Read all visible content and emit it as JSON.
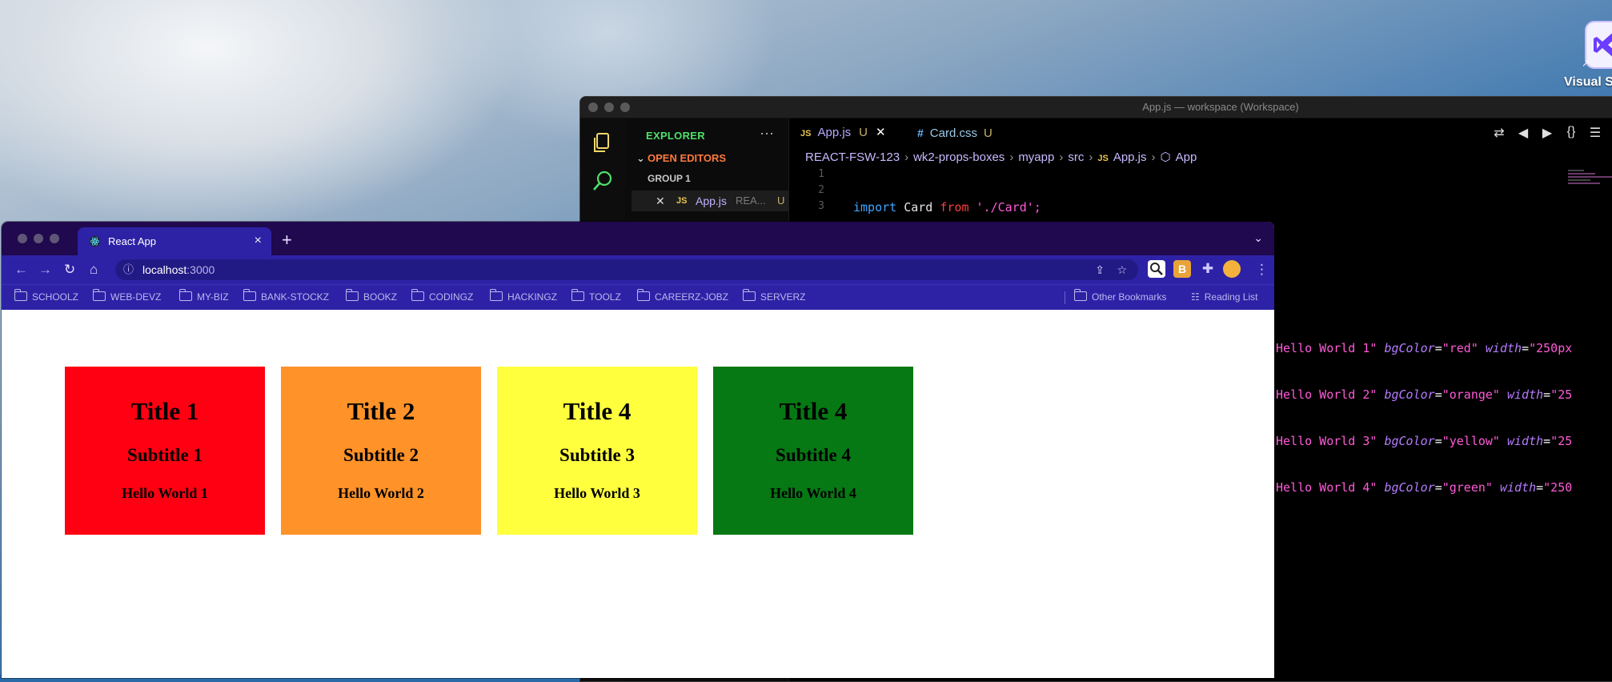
{
  "desktop": {
    "vs_icon_label": "Visual S",
    "vs_icon_alias": "↗"
  },
  "vscode": {
    "window_title": "App.js — workspace (Workspace)",
    "sidebar": {
      "header": "EXPLORER",
      "more": "···",
      "section": "OPEN EDITORS",
      "group": "GROUP 1",
      "file": {
        "close": "✕",
        "icon": "JS",
        "name": "App.js",
        "dir": "REA...",
        "status": "U"
      }
    },
    "tabs": [
      {
        "icon": "JS",
        "label": "App.js",
        "status": "U",
        "close": "✕"
      },
      {
        "icon": "#",
        "label": "Card.css",
        "status": "U"
      }
    ],
    "breadcrumb": [
      "REACT-FSW-123",
      "wk2-props-boxes",
      "myapp",
      "src",
      "App.js",
      "App"
    ],
    "breadcrumb_js_icon": "JS",
    "breadcrumb_symbol_icon": "⬡",
    "code_lines": [
      {
        "num": "1"
      },
      {
        "num": "2"
      },
      {
        "num": "3",
        "import": "import",
        "ident": "Card",
        "from": "from",
        "path": "'./Card';"
      }
    ],
    "peek_lines": [
      {
        "text": "Hello World 1\"",
        "attr1": "bgColor",
        "val1": "\"red\"",
        "attr2": "width",
        "val2": "\"250px"
      },
      {
        "text": "Hello World 2\"",
        "attr1": "bgColor",
        "val1": "\"orange\"",
        "attr2": "width",
        "val2": "\"25"
      },
      {
        "text": "Hello World 3\"",
        "attr1": "bgColor",
        "val1": "\"yellow\"",
        "attr2": "width",
        "val2": "\"25"
      },
      {
        "text": "Hello World 4\"",
        "attr1": "bgColor",
        "val1": "\"green\"",
        "attr2": "width",
        "val2": "\"250"
      }
    ]
  },
  "browser": {
    "tab_title": "React App",
    "tab_close": "×",
    "new_tab": "+",
    "tab_menu": "⌄",
    "url_host": "localhost",
    "url_port": ":3000",
    "bookmarks": [
      "SCHOOLZ",
      "WEB-DEVZ",
      "MY-BIZ",
      "BANK-STOCKZ",
      "BOOKZ",
      "CODINGZ",
      "HACKINGZ",
      "TOOLZ",
      "CAREERZ-JOBZ",
      "SERVERZ"
    ],
    "other_bookmarks": "Other Bookmarks",
    "reading_list": "Reading List",
    "colors": {
      "tabbar": "#20094e",
      "toolbar": "#2d22a6"
    }
  },
  "cards": [
    {
      "title": "Title 1",
      "subtitle": "Subtitle 1",
      "body": "Hello World 1",
      "color": "#ff0012"
    },
    {
      "title": "Title 2",
      "subtitle": "Subtitle 2",
      "body": "Hello World 2",
      "color": "#ff9228"
    },
    {
      "title": "Title 4",
      "subtitle": "Subtitle 3",
      "body": "Hello World 3",
      "color": "#ffff3e"
    },
    {
      "title": "Title 4",
      "subtitle": "Subtitle 4",
      "body": "Hello World 4",
      "color": "#067814"
    }
  ]
}
